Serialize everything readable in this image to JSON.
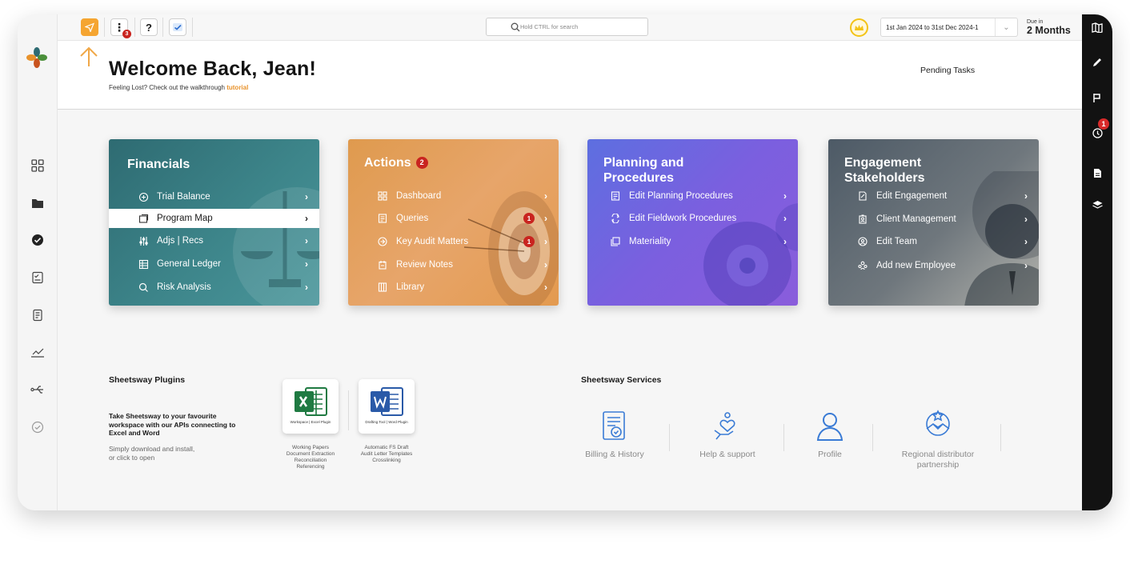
{
  "topbar": {
    "search_placeholder": "Hold CTRL for search",
    "menu_badge": "3",
    "help_label": "?",
    "date_range": "1st Jan 2024 to 31st Dec 2024-1",
    "due_label": "Due in",
    "due_value": "2 Months"
  },
  "header": {
    "title": "Welcome Back, Jean!",
    "lost_text": "Feeling Lost? Check out the walkthrough",
    "tutorial_link": "tutorial",
    "pending_tasks": "Pending Tasks"
  },
  "right_bar": {
    "badge": "1"
  },
  "cards": {
    "financials": {
      "title": "Financials",
      "items": [
        {
          "label": "Trial Balance"
        },
        {
          "label": "Program Map"
        },
        {
          "label": "Adjs | Recs"
        },
        {
          "label": "General Ledger"
        },
        {
          "label": "Risk Analysis"
        }
      ]
    },
    "actions": {
      "title": "Actions",
      "badge": "2",
      "items": [
        {
          "label": "Dashboard"
        },
        {
          "label": "Queries",
          "badge": "1"
        },
        {
          "label": "Key Audit Matters",
          "badge": "1"
        },
        {
          "label": "Review Notes"
        },
        {
          "label": "Library"
        }
      ]
    },
    "planning": {
      "title": "Planning and Procedures",
      "title_line1": "Planning and",
      "title_line2": "Procedures",
      "items": [
        {
          "label": "Edit Planning Procedures"
        },
        {
          "label": "Edit Fieldwork Procedures"
        },
        {
          "label": "Materiality"
        }
      ]
    },
    "engagement": {
      "title": "Engagement Stakeholders",
      "title_line1": "Engagement",
      "title_line2": "Stakeholders",
      "items": [
        {
          "label": "Edit Engagement"
        },
        {
          "label": "Client Management"
        },
        {
          "label": "Edit Team"
        },
        {
          "label": "Add new Employee"
        }
      ]
    }
  },
  "plugins": {
    "title": "Sheetsway Plugins",
    "description": "Take Sheetsway to your favourite workspace with our APIs connecting to Excel and Word",
    "sub_line1": "Simply download and install,",
    "sub_line2": "or click to open",
    "excel": {
      "name": "Workspace | Excel Plugin",
      "caption": [
        "Working Papers",
        "Document Extraction",
        "Reconciliation",
        "Referencing"
      ]
    },
    "word": {
      "name": "Drafting Tool | Word Plugin",
      "caption": [
        "Automatic FS Draft",
        "Audit Letter Templates",
        "Crosslinking"
      ]
    }
  },
  "services": {
    "title": "Sheetsway Services",
    "items": [
      {
        "label": "Billing & History",
        "icon": "billing-icon"
      },
      {
        "label": "Help & support",
        "icon": "help-support-icon"
      },
      {
        "label": "Profile",
        "icon": "profile-icon"
      },
      {
        "label": "Regional distributor partnership",
        "line1": "Regional distributor",
        "line2": "partnership",
        "icon": "handshake-icon"
      }
    ]
  },
  "colors": {
    "accent_orange": "#e8922b",
    "badge_red": "#c9241f",
    "financials": "#3d858a",
    "actions": "#e3a060",
    "planning": "#6d67df",
    "engagement": "#6f777d",
    "service_blue": "#3a7bd5"
  }
}
